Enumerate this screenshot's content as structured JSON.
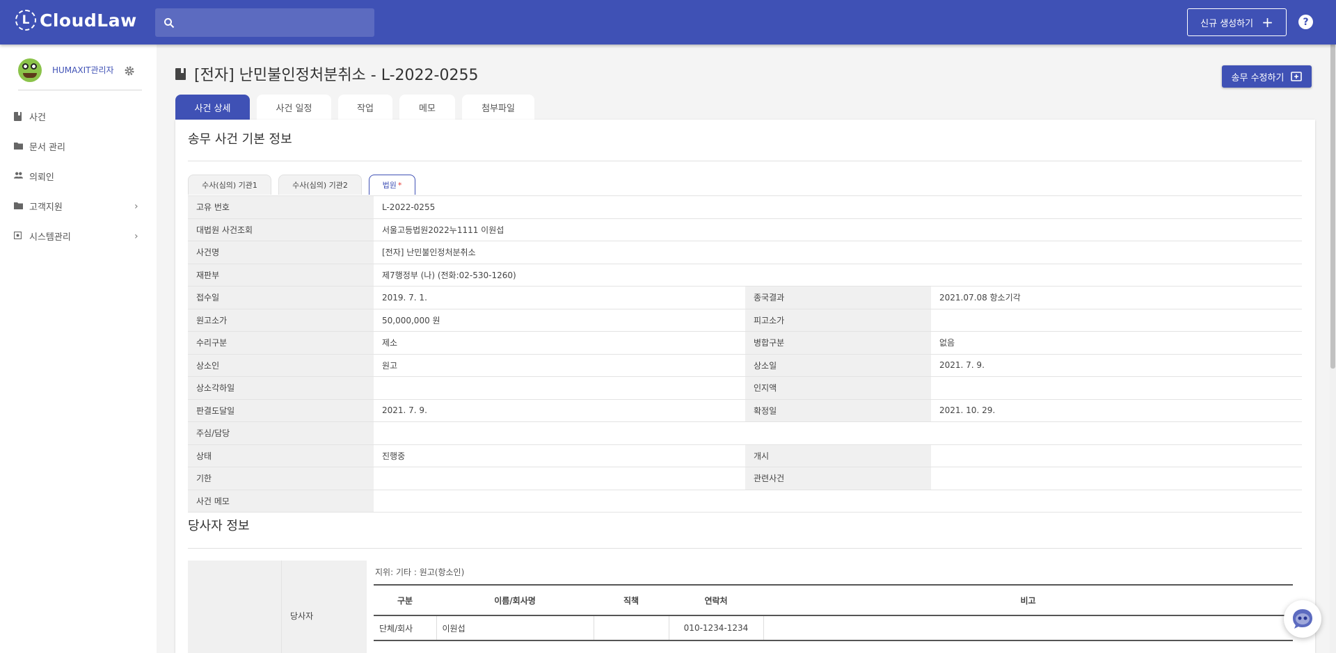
{
  "app": {
    "logo_letter": "L",
    "logo_text": "CloudLaw"
  },
  "header": {
    "search_placeholder": "",
    "new_button_label": "신규 생성하기",
    "new_button_icon": "+",
    "help_icon": "?"
  },
  "sidebar": {
    "user_name": "HUMAXIT관리자",
    "items": [
      {
        "label": "사건",
        "icon": "book-icon",
        "chevron": ""
      },
      {
        "label": "문서 관리",
        "icon": "folder-icon",
        "chevron": ""
      },
      {
        "label": "의뢰인",
        "icon": "people-icon",
        "chevron": ""
      },
      {
        "label": "고객지원",
        "icon": "folder-icon",
        "chevron": "›"
      },
      {
        "label": "시스템관리",
        "icon": "settings-box-icon",
        "chevron": "›"
      }
    ]
  },
  "page": {
    "title": "[전자] 난민불인정처분취소 - L-2022-0255",
    "edit_button_label": "송무 수정하기",
    "tabs": [
      "사건 상세",
      "사건 일정",
      "작업",
      "메모",
      "첨부파일"
    ],
    "active_tab": 0
  },
  "basic_info": {
    "section_title": "송무 사건 기본 정보",
    "subtabs": [
      {
        "label": "수사(심의) 기관1",
        "required": ""
      },
      {
        "label": "수사(심의) 기관2",
        "required": ""
      },
      {
        "label": "법원",
        "required": "*"
      }
    ],
    "rows_full": [
      {
        "label": "고유 번호",
        "value": "L-2022-0255"
      },
      {
        "label": "대법원 사건조회",
        "value": "서울고등법원2022누1111 이원섭"
      },
      {
        "label": "사건명",
        "value": "[전자] 난민불인정처분취소"
      },
      {
        "label": "재판부",
        "value": "제7행정부 (나) (전화:02-530-1260)"
      }
    ],
    "rows_pair": [
      {
        "l1": "접수일",
        "v1": "2019. 7. 1.",
        "l2": "종국결과",
        "v2": "2021.07.08 항소기각"
      },
      {
        "l1": "원고소가",
        "v1": "50,000,000 원",
        "l2": "피고소가",
        "v2": ""
      },
      {
        "l1": "수리구분",
        "v1": "제소",
        "l2": "병합구분",
        "v2": "없음"
      },
      {
        "l1": "상소인",
        "v1": "원고",
        "l2": "상소일",
        "v2": "2021. 7. 9."
      },
      {
        "l1": "상소각하일",
        "v1": "",
        "l2": "인지액",
        "v2": ""
      },
      {
        "l1": "판결도달일",
        "v1": "2021. 7. 9.",
        "l2": "확정일",
        "v2": "2021. 10. 29."
      }
    ],
    "row_manager": {
      "label": "주심/담당",
      "value": ""
    },
    "rows_pair2": [
      {
        "l1": "상태",
        "v1": "진행중",
        "l2": "개시",
        "v2": ""
      },
      {
        "l1": "기한",
        "v1": "",
        "l2": "관련사건",
        "v2": ""
      }
    ],
    "row_memo": {
      "label": "사건 메모",
      "value": ""
    }
  },
  "party_info": {
    "section_title": "당사자 정보",
    "row_label": "당사자",
    "role_text": "지위:  기타  :  원고(항소인)",
    "columns": [
      "구분",
      "이름/회사명",
      "직책",
      "연락처",
      "비고"
    ],
    "rows": [
      {
        "type": "단체/회사",
        "name": "이원섭",
        "position": "",
        "contact": "010-1234-1234",
        "note": ""
      }
    ]
  }
}
